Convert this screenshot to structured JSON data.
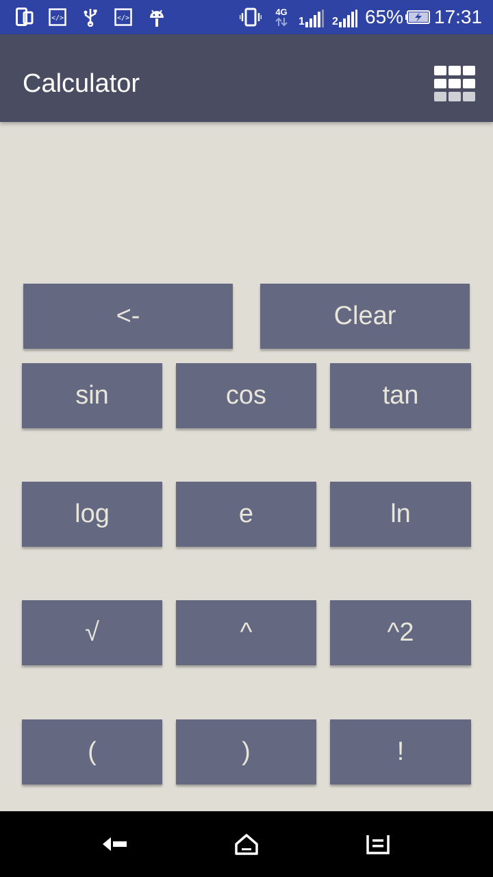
{
  "status_bar": {
    "network_type": "4G",
    "sim1_label": "1",
    "sim2_label": "2",
    "battery_percent": "65%",
    "time": "17:31",
    "icons": [
      "screen-mirror-icon",
      "code-icon",
      "usb-icon",
      "code-icon",
      "android-icon",
      "vibrate-icon",
      "signal-icon",
      "battery-charging-icon"
    ]
  },
  "app_bar": {
    "title": "Calculator",
    "menu_icon": "grid-icon"
  },
  "display": {
    "expression": ""
  },
  "buttons": {
    "backspace": "<-",
    "clear": "Clear",
    "sin": "sin",
    "cos": "cos",
    "tan": "tan",
    "log": "log",
    "e": "e",
    "ln": "ln",
    "sqrt": "√",
    "power": "^",
    "square": "^2",
    "open_paren": "(",
    "close_paren": ")",
    "factorial": "!"
  },
  "nav_bar": {
    "icons": [
      "back-icon",
      "home-icon",
      "recents-icon"
    ]
  },
  "colors": {
    "status_bar": "#2e43a4",
    "app_bar": "#4a4d61",
    "background": "#dfddd4",
    "button": "#646880",
    "button_text": "#e8e6da"
  }
}
